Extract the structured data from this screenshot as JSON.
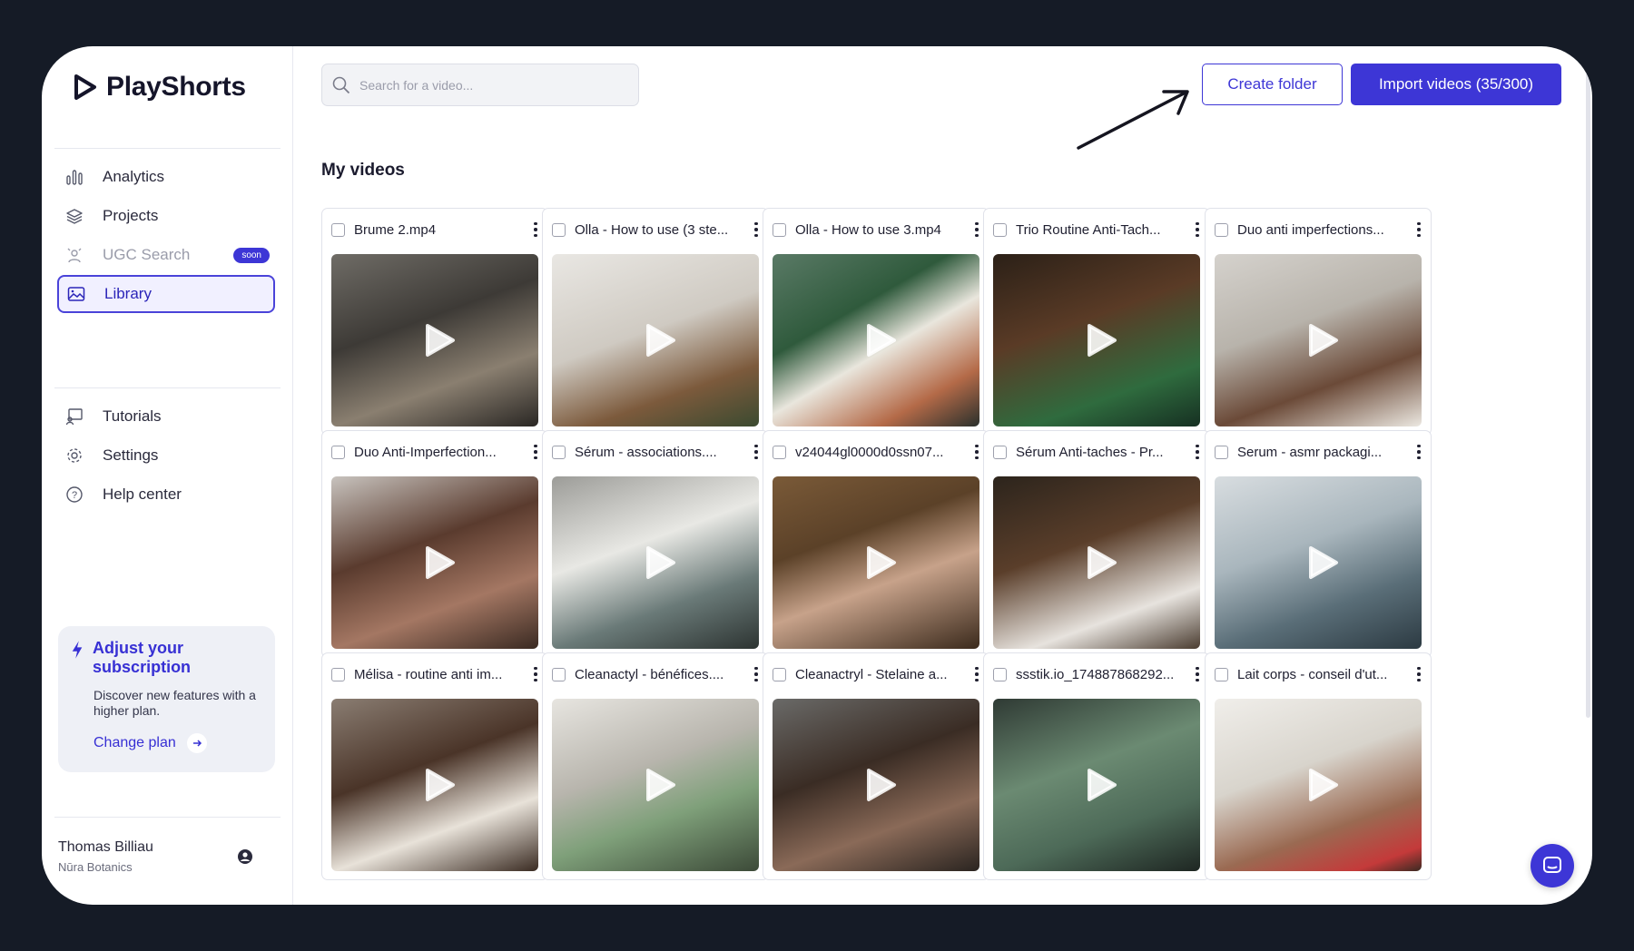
{
  "app": {
    "name": "PlayShorts"
  },
  "nav": {
    "items": [
      {
        "label": "Analytics",
        "icon": "bar-chart-icon"
      },
      {
        "label": "Projects",
        "icon": "layers-icon"
      },
      {
        "label": "UGC Search",
        "icon": "person-search-icon",
        "badge": "soon",
        "disabled": true
      },
      {
        "label": "Library",
        "icon": "image-icon",
        "active": true
      }
    ],
    "secondary": [
      {
        "label": "Tutorials",
        "icon": "presentation-icon"
      },
      {
        "label": "Settings",
        "icon": "gear-icon"
      },
      {
        "label": "Help center",
        "icon": "help-circle-icon"
      }
    ]
  },
  "upgrade": {
    "title": "Adjust your subscription",
    "description": "Discover new features with a higher plan.",
    "cta": "Change plan"
  },
  "user": {
    "name": "Thomas Billiau",
    "org": "Nūra Botanics"
  },
  "search": {
    "placeholder": "Search for a video..."
  },
  "toolbar": {
    "create_folder": "Create folder",
    "import_videos": "Import videos (35/300)"
  },
  "section": {
    "title": "My videos"
  },
  "videos": [
    {
      "title": "Brume 2.mp4"
    },
    {
      "title": "Olla - How to use (3 ste..."
    },
    {
      "title": "Olla - How to use 3.mp4"
    },
    {
      "title": "Trio Routine Anti-Tach..."
    },
    {
      "title": "Duo anti imperfections..."
    },
    {
      "title": "Duo Anti-Imperfection..."
    },
    {
      "title": "Sérum - associations...."
    },
    {
      "title": "v24044gl0000d0ssn07..."
    },
    {
      "title": "Sérum Anti-taches - Pr..."
    },
    {
      "title": "Serum - asmr packagi..."
    },
    {
      "title": "Mélisa - routine anti im..."
    },
    {
      "title": "Cleanactyl - bénéfices...."
    },
    {
      "title": "Cleanactryl - Stelaine a..."
    },
    {
      "title": "ssstik.io_174887868292..."
    },
    {
      "title": "Lait corps - conseil d'ut..."
    }
  ],
  "colors": {
    "accent": "#3d36d6",
    "frame": "#151b26"
  }
}
